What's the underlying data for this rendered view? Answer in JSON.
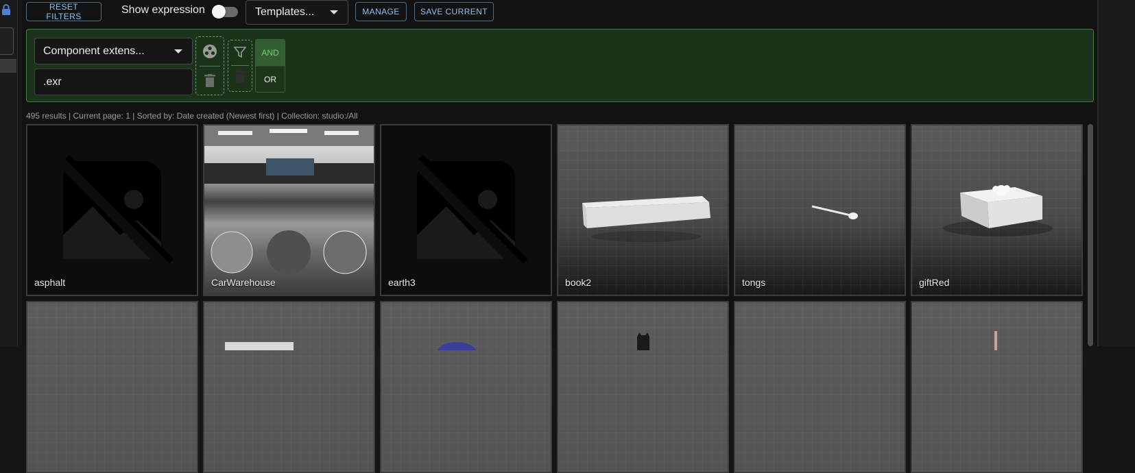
{
  "toolbar": {
    "reset_label": "RESET FILTERS",
    "show_expression_label": "Show expression",
    "show_expression_on": false,
    "templates_label": "Templates...",
    "manage_label": "MANAGE",
    "save_current_label": "SAVE CURRENT"
  },
  "filter": {
    "field_select": "Component extens...",
    "value": ".exr",
    "and_label": "AND",
    "or_label": "OR",
    "active_operator": "AND"
  },
  "status_text": "495 results | Current page: 1 | Sorted by: Date created (Newest first) | Collection: studio:/All",
  "assets": [
    {
      "name": "asphalt",
      "thumb": "no-image-icon"
    },
    {
      "name": "CarWarehouse",
      "thumb": "hdri-preview"
    },
    {
      "name": "earth3",
      "thumb": "no-image-icon"
    },
    {
      "name": "book2",
      "thumb": "render-book"
    },
    {
      "name": "tongs",
      "thumb": "render-tongs"
    },
    {
      "name": "giftRed",
      "thumb": "render-gift"
    },
    {
      "name": "",
      "thumb": "render-grey"
    },
    {
      "name": "",
      "thumb": "render-box"
    },
    {
      "name": "",
      "thumb": "render-blue"
    },
    {
      "name": "",
      "thumb": "render-figure"
    },
    {
      "name": "",
      "thumb": "render-grey"
    },
    {
      "name": "",
      "thumb": "render-stick"
    }
  ],
  "colors": {
    "accent": "#8fc3ee",
    "filter_bg": "#1b3419",
    "and_active": "#79d06f"
  }
}
